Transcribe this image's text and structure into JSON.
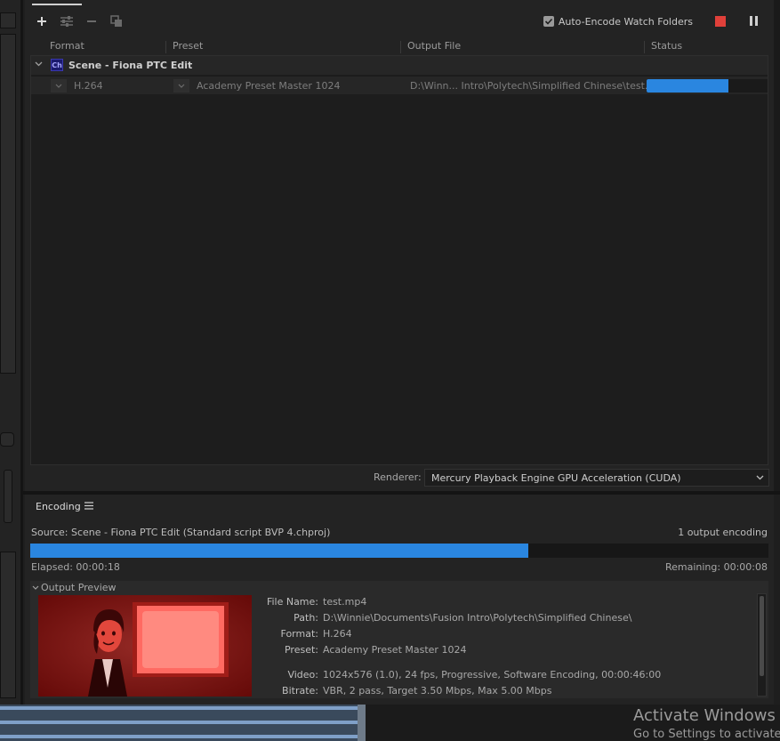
{
  "queue": {
    "auto_encode_label": "Auto-Encode Watch Folders",
    "auto_encode_checked": true,
    "columns": {
      "format": "Format",
      "preset": "Preset",
      "output_file": "Output File",
      "status": "Status"
    },
    "group": {
      "badge": "Ch",
      "name": "Scene - Fiona PTC Edit"
    },
    "item": {
      "format": "H.264",
      "preset": "Academy Preset Master 1024",
      "output_file": "D:\\Winn... Intro\\Polytech\\Simplified Chinese\\test.mp4",
      "progress": 0.68
    },
    "renderer_label": "Renderer:",
    "renderer_value": "Mercury Playback Engine GPU Acceleration (CUDA)"
  },
  "encoding": {
    "tab_label": "Encoding",
    "source": "Source: Scene - Fiona PTC Edit (Standard script BVP 4.chproj)",
    "output_count": "1 output encoding",
    "progress": 0.675,
    "elapsed": "Elapsed: 00:00:18",
    "remaining": "Remaining: 00:00:08",
    "preview_title": "Output Preview",
    "meta": {
      "file_name_label": "File Name:",
      "file_name": "test.mp4",
      "path_label": "Path:",
      "path": "D:\\Winnie\\Documents\\Fusion Intro\\Polytech\\Simplified Chinese\\",
      "format_label": "Format:",
      "format": "H.264",
      "preset_label": "Preset:",
      "preset": "Academy Preset Master 1024",
      "video_label": "Video:",
      "video": "1024x576 (1.0), 24 fps, Progressive, Software Encoding, 00:00:46:00",
      "bitrate_label": "Bitrate:",
      "bitrate": "VBR, 2 pass, Target 3.50 Mbps, Max 5.00 Mbps"
    }
  },
  "watermark": {
    "title": "Activate Windows",
    "subtitle": "Go to Settings to activate"
  },
  "colors": {
    "accent": "#2a86e0",
    "stop": "#e0403a"
  }
}
